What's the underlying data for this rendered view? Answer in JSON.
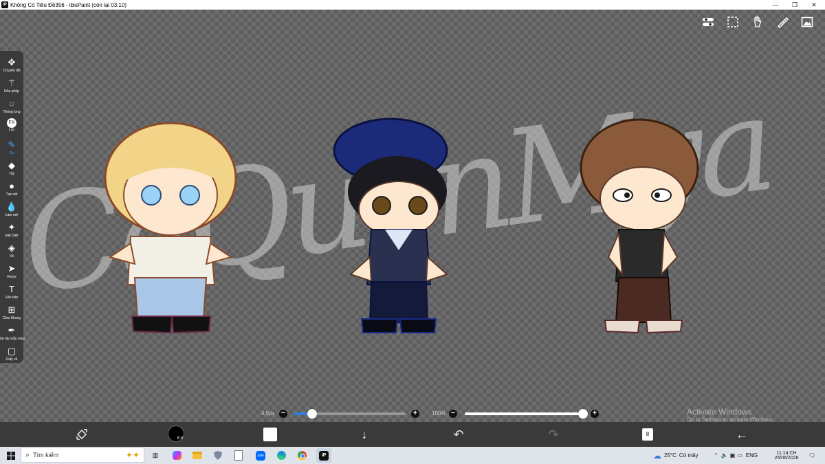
{
  "window": {
    "title": "Không Có Tiêu Đề356 - ibisPaint (còn lại 03:10)",
    "app_icon": "iP",
    "controls": [
      "minimize-icon",
      "maximize-icon",
      "close-icon"
    ]
  },
  "canvas": {
    "watermark": "CaQuynMya",
    "top_icons": [
      "layer-toggle-icon",
      "selection-icon",
      "hand-icon",
      "ruler-icon",
      "reference-icon"
    ]
  },
  "toolbar": {
    "tools": [
      {
        "label": "Chuyển đổi",
        "icon": "move-icon",
        "glyph": "✥"
      },
      {
        "label": "Đũa phép",
        "icon": "magic-wand-icon",
        "glyph": "⚚"
      },
      {
        "label": "Thòng lọng",
        "icon": "lasso-icon",
        "glyph": "◌"
      },
      {
        "label": "Lọc",
        "icon": "filter-fx-icon",
        "glyph": "FX"
      },
      {
        "label": "Cọ",
        "icon": "brush-icon",
        "glyph": "✎",
        "active": true
      },
      {
        "label": "Tẩy",
        "icon": "eraser-icon",
        "glyph": "◆"
      },
      {
        "label": "Tạo vết",
        "icon": "smudge-icon",
        "glyph": "●"
      },
      {
        "label": "Làm mờ",
        "icon": "blur-icon",
        "glyph": "💧"
      },
      {
        "label": "Đặc biệt",
        "icon": "special-icon",
        "glyph": "✦"
      },
      {
        "label": "Xô",
        "icon": "bucket-icon",
        "glyph": "◈"
      },
      {
        "label": "Vector",
        "icon": "vector-icon",
        "glyph": "➤"
      },
      {
        "label": "Văn bản",
        "icon": "text-icon",
        "glyph": "T"
      },
      {
        "label": "Chia Khung",
        "icon": "frame-divider-icon",
        "glyph": "⊞"
      },
      {
        "label": "Bút lấy mẫu màu",
        "icon": "eyedropper-icon",
        "glyph": "✒"
      },
      {
        "label": "Giấy vẽ",
        "icon": "canvas-paper-icon",
        "glyph": "▢"
      }
    ]
  },
  "sliders": {
    "size": {
      "label": "4.5px",
      "value_fraction": 0.16
    },
    "opacity": {
      "label": "100%",
      "value_fraction": 1.0
    }
  },
  "bottom_bar": {
    "layer_count": "8",
    "brush_size_label": "8.0",
    "current_color": "#ffffff"
  },
  "activate_windows": {
    "line1": "Activate Windows",
    "line2": "Go to Settings to activate Windows."
  },
  "taskbar": {
    "search_placeholder": "Tìm kiếm",
    "weather_temp": "25°C",
    "weather_text": "Có mây",
    "language": "ENG",
    "time": "11:14 CH",
    "date": "25/06/2026",
    "zalo_label": "Zalo"
  },
  "colors": {
    "accent": "#2f7de1",
    "toolbar_bg": "#3a3a3a",
    "active_tool": "#4aa3ff"
  }
}
